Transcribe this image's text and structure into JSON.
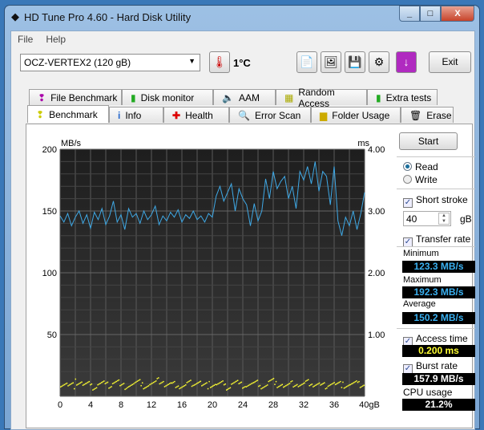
{
  "window": {
    "title": "HD Tune Pro 4.60 - Hard Disk Utility",
    "minimize": "_",
    "maximize": "□",
    "close": "X"
  },
  "menu": [
    "File",
    "Help"
  ],
  "toolbar": {
    "drive": "OCZ-VERTEX2 (120 gB)",
    "temperature": "1°C",
    "exit": "Exit"
  },
  "tabs_top": [
    "File Benchmark",
    "Disk monitor",
    "AAM",
    "Random Access",
    "Extra tests"
  ],
  "tabs_bottom": [
    "Benchmark",
    "Info",
    "Health",
    "Error Scan",
    "Folder Usage",
    "Erase"
  ],
  "side": {
    "start": "Start",
    "read": "Read",
    "write": "Write",
    "short_stroke": "Short stroke",
    "stroke_value": "40",
    "stroke_unit": "gB",
    "transfer_rate": "Transfer rate",
    "minimum_label": "Minimum",
    "minimum": "123.3 MB/s",
    "maximum_label": "Maximum",
    "maximum": "192.3 MB/s",
    "average_label": "Average",
    "average": "150.2 MB/s",
    "access_time_label": "Access time",
    "access_time": "0.200 ms",
    "burst_rate_label": "Burst rate",
    "burst_rate": "157.9 MB/s",
    "cpu_label": "CPU usage",
    "cpu": "21.2%"
  },
  "colors": {
    "transfer": "#3fa9e6",
    "access": "#ffff30",
    "plot_bg": "#2a2a2a"
  },
  "chart_data": {
    "type": "line",
    "ylabel_left": "MB/s",
    "ylabel_right": "ms",
    "xlabel_suffix": "gB",
    "ylim_left": [
      0,
      200
    ],
    "ylim_right": [
      0,
      4
    ],
    "xlim": [
      0,
      40
    ],
    "yticks_left": [
      "200",
      "150",
      "100",
      "50"
    ],
    "yticks_right": [
      "4.00",
      "3.00",
      "2.00",
      "1.00"
    ],
    "xticks": [
      "0",
      "4",
      "8",
      "12",
      "16",
      "20",
      "24",
      "28",
      "32",
      "36",
      "40gB"
    ],
    "transfer_series": [
      146,
      141,
      148,
      138,
      145,
      150,
      140,
      147,
      136,
      149,
      143,
      152,
      139,
      146,
      158,
      141,
      147,
      135,
      152,
      145,
      148,
      140,
      150,
      143,
      147,
      154,
      139,
      146,
      142,
      149,
      145,
      151,
      141,
      147,
      144,
      150,
      143,
      146,
      141,
      148,
      145,
      162,
      170,
      158,
      165,
      172,
      150,
      168,
      160,
      155,
      138,
      156,
      142,
      150,
      176,
      160,
      182,
      168,
      174,
      178,
      160,
      170,
      152,
      182,
      175,
      186,
      172,
      190,
      166,
      182,
      178,
      155,
      186,
      142,
      130,
      145,
      138,
      150,
      135,
      148,
      165
    ],
    "access_series": [
      0.21,
      0.18,
      0.24,
      0.2,
      0.16,
      0.22,
      0.19,
      0.25,
      0.17,
      0.2,
      0.23,
      0.18,
      0.21,
      0.26,
      0.19,
      0.2,
      0.17,
      0.22,
      0.24,
      0.18,
      0.2,
      0.21,
      0.16,
      0.23,
      0.19,
      0.2,
      0.22,
      0.18,
      0.25,
      0.2,
      0.17,
      0.21,
      0.19,
      0.23,
      0.2,
      0.18,
      0.22,
      0.2,
      0.19,
      0.21,
      0.2
    ]
  }
}
